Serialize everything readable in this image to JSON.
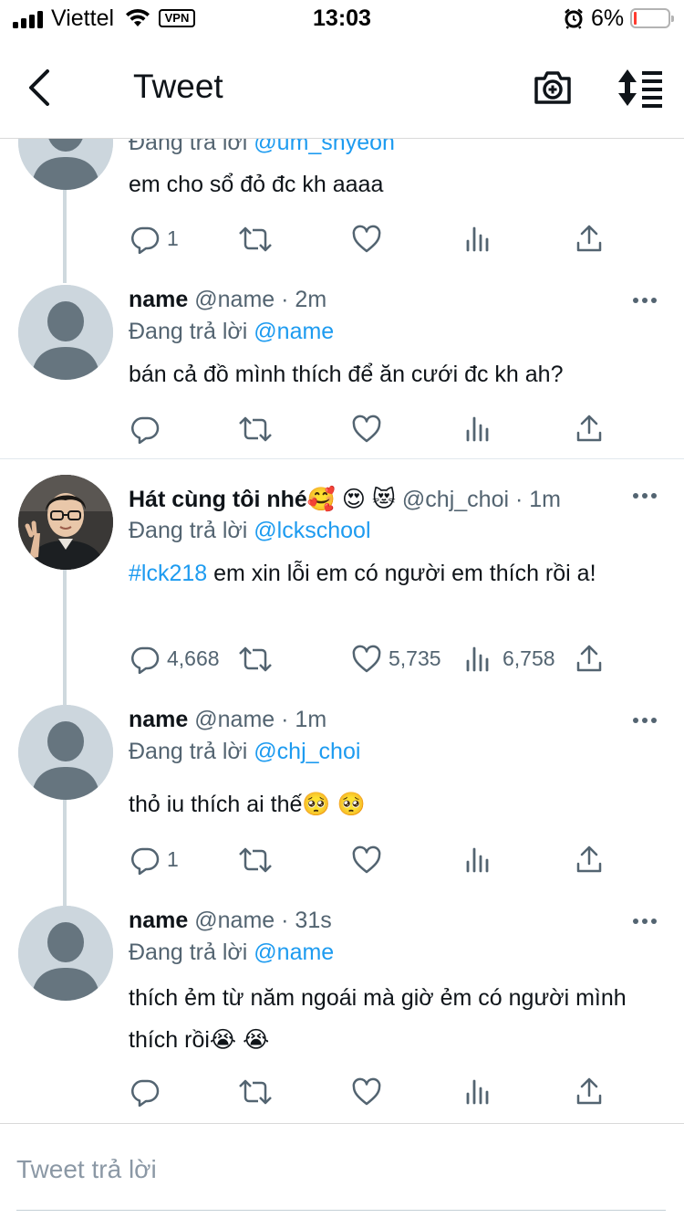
{
  "status_bar": {
    "carrier": "Viettel",
    "vpn": "VPN",
    "time": "13:03",
    "battery": "6%"
  },
  "header": {
    "title": "Tweet"
  },
  "tweets": [
    {
      "reply_prefix": "Đang trả lời",
      "reply_to": "@um_snyeon",
      "text": "em cho sổ đỏ đc kh aaaa",
      "replies": "1",
      "retweets": "",
      "likes": "",
      "views": ""
    },
    {
      "name": "name",
      "handle": "@name",
      "time": "· 2m",
      "reply_prefix": "Đang trả lời",
      "reply_to": "@name",
      "text": "bán cả đồ mình thích để ăn cưới đc kh ah?",
      "replies": "",
      "retweets": "",
      "likes": "",
      "views": ""
    },
    {
      "name": "Hát cùng tôi nhé🥰 😍 😻",
      "handle": "@chj_choi",
      "time": "· 1m",
      "reply_prefix": "Đang trả lời",
      "reply_to": "@lckschool",
      "hashtag": "#lck218",
      "text": " em xin lỗi em có người em thích rồi a!",
      "replies": "4,668",
      "retweets": "",
      "likes": "5,735",
      "views": "6,758"
    },
    {
      "name": "name",
      "handle": "@name",
      "time": "· 1m",
      "reply_prefix": "Đang trả lời",
      "reply_to": "@chj_choi",
      "text": "thỏ iu thích ai thế🥺 🥺",
      "replies": "1",
      "retweets": "",
      "likes": "",
      "views": ""
    },
    {
      "name": "name",
      "handle": "@name",
      "time": "· 31s",
      "reply_prefix": "Đang trả lời",
      "reply_to": "@name",
      "text": "thích ẻm từ năm ngoái mà giờ ẻm có người mình thích rồi😭 😭",
      "replies": "",
      "retweets": "",
      "likes": "",
      "views": ""
    }
  ],
  "composer": {
    "placeholder": "Tweet trả lời"
  },
  "colors": {
    "accent": "#1d9bf0",
    "secondary_text": "#536471",
    "thread_line": "#cfd9de"
  }
}
